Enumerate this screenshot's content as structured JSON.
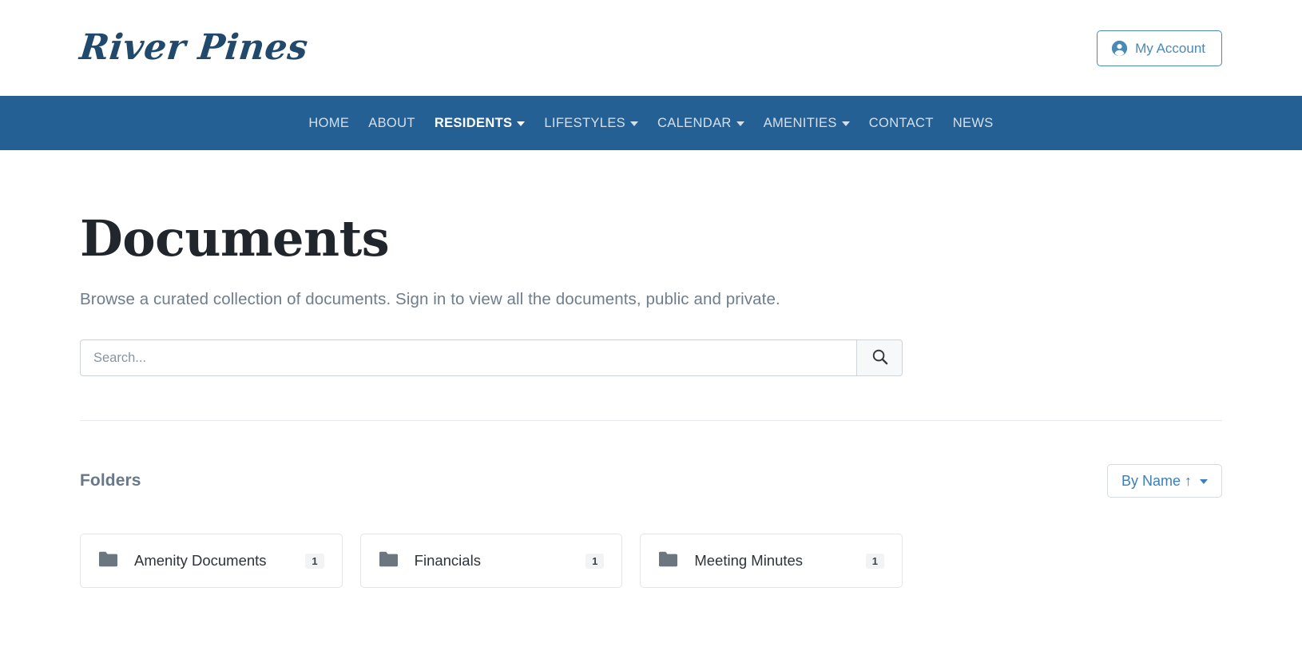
{
  "header": {
    "brand": "River Pines",
    "account_button": {
      "label": "My Account",
      "icon": "account-circle-icon"
    }
  },
  "nav": {
    "items": [
      {
        "label": "HOME",
        "has_caret": false,
        "active": false
      },
      {
        "label": "ABOUT",
        "has_caret": false,
        "active": false
      },
      {
        "label": "RESIDENTS",
        "has_caret": true,
        "active": true
      },
      {
        "label": "LIFESTYLES",
        "has_caret": true,
        "active": false
      },
      {
        "label": "CALENDAR",
        "has_caret": true,
        "active": false
      },
      {
        "label": "AMENITIES",
        "has_caret": true,
        "active": false
      },
      {
        "label": "CONTACT",
        "has_caret": false,
        "active": false
      },
      {
        "label": "NEWS",
        "has_caret": false,
        "active": false
      }
    ]
  },
  "main": {
    "title": "Documents",
    "description": "Browse a curated collection of documents. Sign in to view all the documents, public and private.",
    "search": {
      "value": "",
      "placeholder": "Search...",
      "button_icon": "search-icon"
    },
    "folders_section": {
      "title": "Folders",
      "sort": {
        "label": "By Name ↑",
        "caret_icon": "chevron-down-icon"
      },
      "folders": [
        {
          "name": "Amenity Documents",
          "count": "1",
          "icon": "folder-icon"
        },
        {
          "name": "Financials",
          "count": "1",
          "icon": "folder-icon"
        },
        {
          "name": "Meeting Minutes",
          "count": "1",
          "icon": "folder-icon"
        }
      ]
    }
  },
  "colors": {
    "nav_bg": "#246094",
    "brand": "#21496b",
    "accent_link": "#3a7fbf",
    "account_border": "#4a8ab5",
    "folder_icon": "#6b7681",
    "muted_text": "#6f7d8c"
  }
}
